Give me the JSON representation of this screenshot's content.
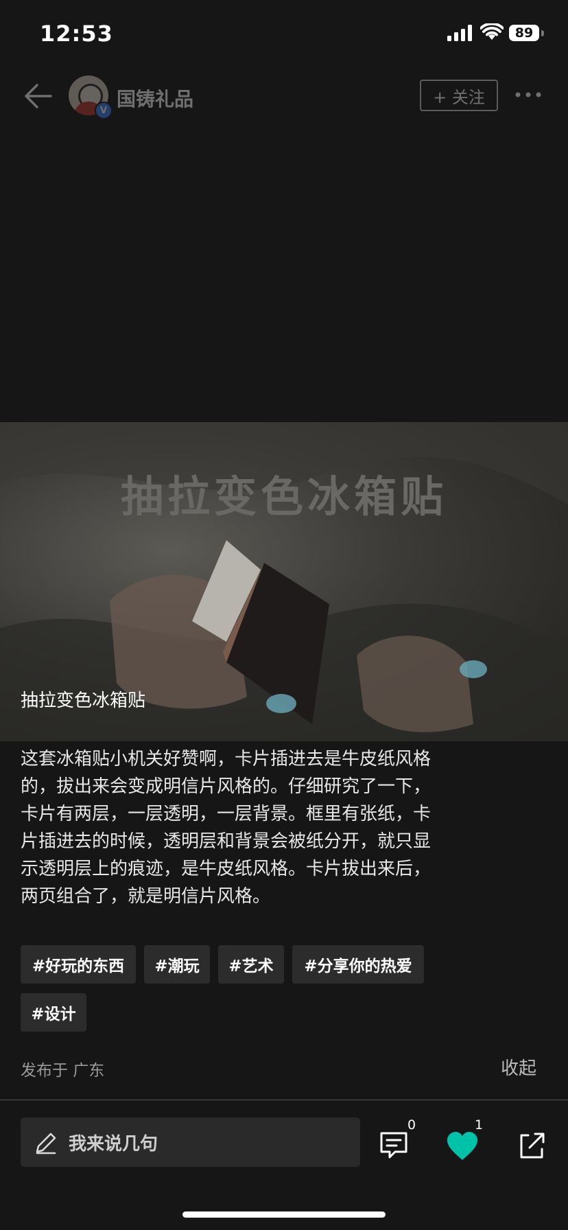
{
  "status_bar": {
    "time": "12:53",
    "battery": "89"
  },
  "header": {
    "account_name": "国铸礼品",
    "follow_label": "+ 关注",
    "verified_mark": "V"
  },
  "image": {
    "title": "抽拉变色冰箱贴",
    "caption": "抽拉变色冰箱贴"
  },
  "description": "这套冰箱贴小机关好赞啊，卡片插进去是牛皮纸风格的，拔出来会变成明信片风格的。仔细研究了一下，卡片有两层，一层透明，一层背景。框里有张纸，卡片插进去的时候，透明层和背景会被纸分开，就只显示透明层上的痕迹，是牛皮纸风格。卡片拔出来后，两页组合了，就是明信片风格。",
  "tags": [
    "#好玩的东西",
    "#潮玩",
    "#艺术",
    "#分享你的热爱",
    "#设计"
  ],
  "location": "发布于 广东",
  "collapse_label": "收起",
  "bottom_bar": {
    "comment_placeholder": "我来说几句",
    "comment_count": "0",
    "like_count": "1"
  },
  "colors": {
    "like_accent": "#00c2a8",
    "background": "#161616"
  }
}
